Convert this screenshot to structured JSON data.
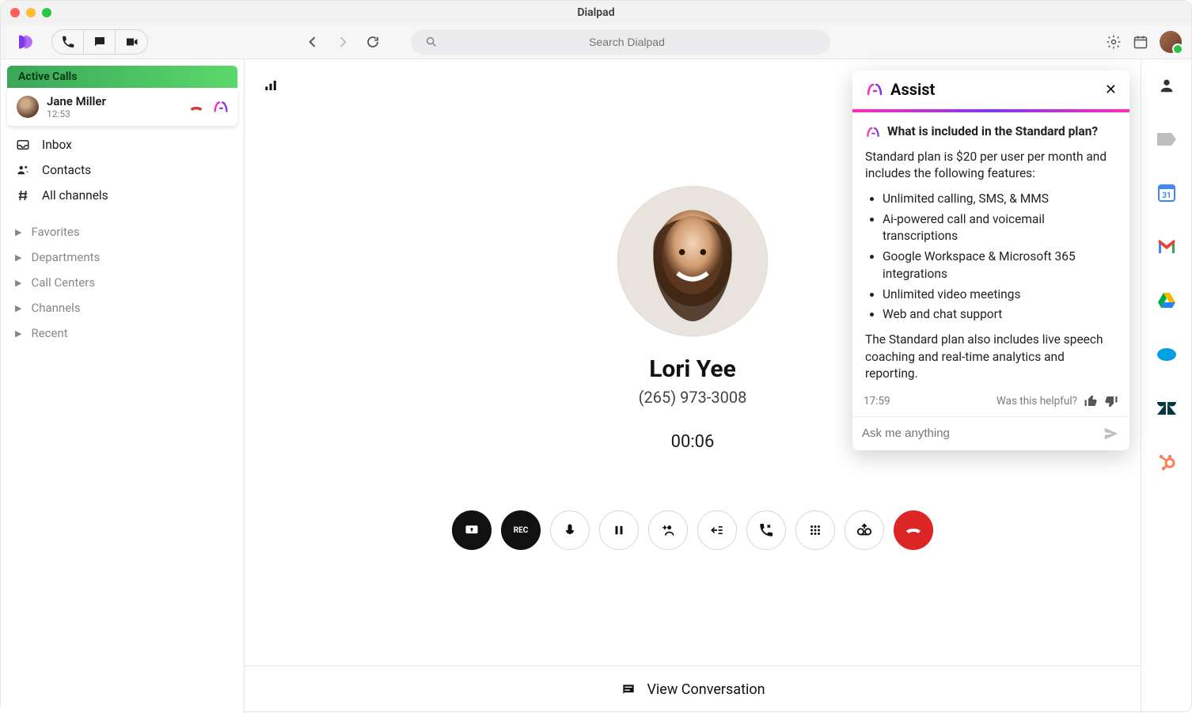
{
  "app_title": "Dialpad",
  "search": {
    "placeholder": "Search Dialpad"
  },
  "sidebar": {
    "active_calls_label": "Active Calls",
    "active_call": {
      "name": "Jane Miller",
      "time": "12:53"
    },
    "inbox": "Inbox",
    "contacts": "Contacts",
    "all_channels": "All channels",
    "groups": [
      "Favorites",
      "Departments",
      "Call Centers",
      "Channels",
      "Recent"
    ]
  },
  "call": {
    "name": "Lori Yee",
    "phone": "(265) 973-3008",
    "timer": "00:06"
  },
  "bottom": {
    "view_conversation": "View Conversation"
  },
  "assist": {
    "title": "Assist",
    "question": "What is included in the Standard plan?",
    "intro": "Standard plan is $20 per user per month and includes the following features:",
    "bullets": [
      "Unlimited calling, SMS, & MMS",
      "Ai-powered call and voicemail transcriptions",
      "Google Workspace & Microsoft 365 integrations",
      "Unlimited video meetings",
      "Web and chat support"
    ],
    "outro": "The Standard plan also includes live speech coaching and real-time analytics and reporting.",
    "timestamp": "17:59",
    "helpful_label": "Was this helpful?",
    "input_placeholder": "Ask me anything"
  },
  "rail": {
    "icons": [
      "person",
      "tag",
      "calendar",
      "gmail",
      "drive",
      "salesforce",
      "zendesk",
      "hubspot"
    ]
  }
}
